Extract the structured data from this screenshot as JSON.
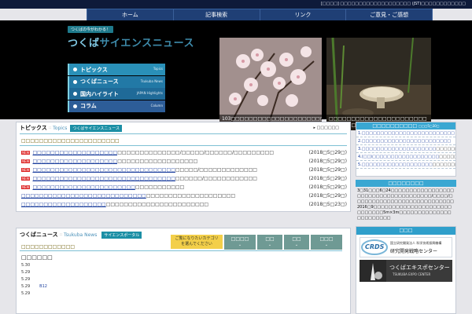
{
  "topstrip": {
    "text": "[□□□□] □□□□□□□□□□□□□□□□□□□ (JST)□□□□□□□□□□□□"
  },
  "nav": {
    "items": [
      "ホーム",
      "記事検索",
      "リンク",
      "ご意見・ご感想"
    ]
  },
  "hero": {
    "tagline": "つくばの今がわかる！",
    "logo_part1": "つくば",
    "logo_part2": "サイエンスニュース",
    "menu": [
      {
        "jp": "トピックス",
        "en": "Topics"
      },
      {
        "jp": "つくばニュース",
        "en": "Tsukuba News"
      },
      {
        "jp": "国内ハイライト",
        "en": "JAPAN Highlights"
      },
      {
        "jp": "コラム",
        "en": "Column"
      }
    ],
    "photos": [
      {
        "caption": "103□□□□□□□□□□□□□□□□□□□□□□□□□ ©□□□□□□□□"
      },
      {
        "caption": "□□□□□□□□□□□□□□□□□□□□□□ ©□□□□□□□□□□□□"
      }
    ]
  },
  "topics": {
    "title": "トピックス",
    "sep": "::",
    "title_en": "Topics",
    "tag": "つくばサイエンスニュース",
    "more": "□□□□□□",
    "subtitle": "□□□□□□□□□□□□□□□□□□□□□□",
    "rows": [
      {
        "new": true,
        "link": "□□□□□□□□□□□□□□□□□□□",
        "desc": "□□□□□□□□□□□□□□/□□□□□/□□□□□□/□□□□□□□□□",
        "date": "(2018□5□29□)"
      },
      {
        "new": true,
        "link": "□□□□□□□□□□□□□□□□□□□",
        "desc": "□□□□□□□□□□□□□□□□□□",
        "date": "(2018□5□29□)"
      },
      {
        "new": true,
        "link": "□□□□□□□□□□□□□□□□□□□□□□□□□□□□□□□□",
        "desc": "□□□□□/□□□□□□□□□□□□□",
        "date": "(2018□5□29□)"
      },
      {
        "new": true,
        "link": "□□□□□□□□□□□□□□□□□□□□□□□□□□□□□□□□",
        "desc": "□□□□□□/□□□□□□□□□□□□",
        "date": "(2018□5□29□)"
      },
      {
        "new": true,
        "link": "□□□□□□□□□□□□□□□□□□□□□□□",
        "desc": "□□□□□□□□□□□",
        "date": "(2018□5□29□)"
      },
      {
        "new": false,
        "link": "□□□□□□□□□□□□□□□□□□□□□□□□□□□□",
        "desc": "□□□□□□□□□□□□□□□□□□□□",
        "date": "(2018□5□29□)"
      },
      {
        "new": false,
        "link": "□□□□□□□□□□□□□□□□□□□",
        "desc": "□□□□□□□□□□□□□□□□□□□□□□□",
        "date": "(2018□5□23□)"
      }
    ]
  },
  "news": {
    "title": "つくばニュース",
    "sep": "::",
    "title_en": "Tsukuba News",
    "portal_btn": "サイエンスポータル",
    "picker": "ご覧になりたいカテゴリ\nを選んでください",
    "categories": [
      "□□□□",
      "□□",
      "□□",
      "□□□"
    ],
    "subtitle": "□□□□□□□□□□□□",
    "heading": "□□□□□□",
    "rows": [
      {
        "date": "5.30",
        "link": ""
      },
      {
        "date": "5.29",
        "link": ""
      },
      {
        "date": "5.29",
        "link": ""
      },
      {
        "date": "5.29",
        "link": "B12"
      },
      {
        "date": "5.29",
        "link": ""
      }
    ]
  },
  "side_panel": {
    "title": "□□□□□□□□□□",
    "title_small": "□□□5□30□",
    "rows": [
      {
        "num": "1.",
        "link": "□□□□□□□□□□□□□□□□□□□□□□□□□",
        "desc": ""
      },
      {
        "num": "2.",
        "link": "□□□□□□□□□□□□□□□□□□□□□□□□",
        "desc": ""
      },
      {
        "num": "3.",
        "link": "□□□□□□□□□□□□□□□□□□□□",
        "desc": "□□□□□□□"
      },
      {
        "num": "4.",
        "link": "(□□)□□□□□□□□□□□□□□□□□□",
        "desc": "□□□□□□□□□□□□□"
      },
      {
        "num": "5.",
        "link": "□□□□□□□□□□□□□□□□□□□",
        "desc": "□□□□□□□□□□□□□□□□□□□"
      }
    ]
  },
  "side_event": {
    "title": "□□□□□□□□",
    "text": "3□31□□□6□24□□□□□□□□□□□□□□□□□□□□□□□□□□□□□□□□□□□□□/□□□□/□□□□□□□□□□□□□□□□□□□□□□□□□□□2016□9□□□□□□□□□□□□□□□□□□□□□□□□□□□□5m×3m□□□□□□□□□□□□□□□□□□□□□□□"
  },
  "side_banners": {
    "title": "□□□",
    "crds": {
      "mark": "CRDS",
      "org": "国立研究開発法人 科学技術振興機構",
      "name": "研究開発戦略センター"
    },
    "expo": {
      "jp": "つくばエキスポセンター",
      "en": "TSUKUBA EXPO CENTER"
    }
  },
  "colors": {
    "nav": "#1f3f75",
    "accent": "#1b8fa5",
    "new_badge": "#dd2222",
    "link": "#1c3f9e",
    "picker": "#f3cf4a"
  }
}
